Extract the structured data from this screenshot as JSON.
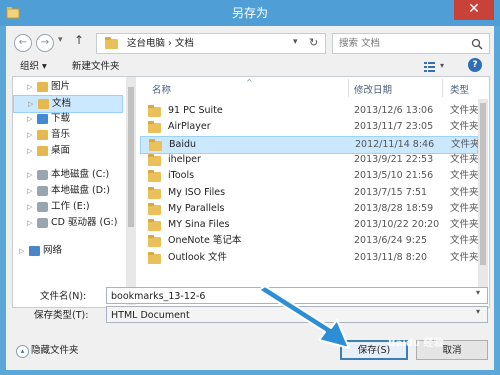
{
  "window": {
    "title": "另存为",
    "close_label": "✕"
  },
  "nav": {
    "back": "←",
    "forward": "→",
    "dropdown": "▾",
    "up": "↑"
  },
  "address": {
    "path": "这台电脑 › 文档",
    "chevron": "▾",
    "refresh": "↻"
  },
  "search": {
    "placeholder": "搜索 文档"
  },
  "toolbar": {
    "organize": "组织 ▾",
    "new_folder": "新建文件夹",
    "help": "?"
  },
  "sidebar": {
    "items": [
      {
        "label": "图片",
        "icon": "pictures-icon",
        "selected": false
      },
      {
        "label": "文档",
        "icon": "documents-icon",
        "selected": true
      },
      {
        "label": "下载",
        "icon": "downloads-icon",
        "selected": false
      },
      {
        "label": "音乐",
        "icon": "music-icon",
        "selected": false
      },
      {
        "label": "桌面",
        "icon": "desktop-icon",
        "selected": false
      },
      {
        "label": "本地磁盘 (C:)",
        "icon": "drive-icon",
        "selected": false
      },
      {
        "label": "本地磁盘 (D:)",
        "icon": "drive-icon",
        "selected": false
      },
      {
        "label": "工作 (E:)",
        "icon": "drive-icon",
        "selected": false
      },
      {
        "label": "CD 驱动器 (G:)",
        "icon": "cd-drive-icon",
        "selected": false
      },
      {
        "label": "网络",
        "icon": "network-icon",
        "selected": false
      }
    ]
  },
  "file_list": {
    "columns": [
      "名称",
      "修改日期",
      "类型"
    ],
    "rows": [
      {
        "name": "91 PC Suite",
        "date": "2013/12/6 13:06",
        "type": "文件夹",
        "selected": false
      },
      {
        "name": "AirPlayer",
        "date": "2013/11/7 23:05",
        "type": "文件夹",
        "selected": false
      },
      {
        "name": "Baidu",
        "date": "2012/11/14 8:46",
        "type": "文件夹",
        "selected": true
      },
      {
        "name": "ihelper",
        "date": "2013/9/21 22:53",
        "type": "文件夹",
        "selected": false
      },
      {
        "name": "iTools",
        "date": "2013/5/10 21:56",
        "type": "文件夹",
        "selected": false
      },
      {
        "name": "My ISO Files",
        "date": "2013/7/15 7:51",
        "type": "文件夹",
        "selected": false
      },
      {
        "name": "My Parallels",
        "date": "2013/8/28 18:59",
        "type": "文件夹",
        "selected": false
      },
      {
        "name": "MY Sina Files",
        "date": "2013/10/22 20:20",
        "type": "文件夹",
        "selected": false
      },
      {
        "name": "OneNote 笔记本",
        "date": "2013/6/24 9:25",
        "type": "文件夹",
        "selected": false
      },
      {
        "name": "Outlook 文件",
        "date": "2013/11/8 8:20",
        "type": "文件夹",
        "selected": false
      }
    ]
  },
  "form": {
    "filename_label": "文件名(N):",
    "filename_value": "bookmarks_13-12-6",
    "filetype_label": "保存类型(T):",
    "filetype_value": "HTML Document"
  },
  "footer": {
    "hide_folders": "隐藏文件夹",
    "save": "保存(S)",
    "cancel": "取消"
  },
  "watermark": "Baidu 经验",
  "colors": {
    "accent": "#4f9fd6",
    "selection": "#cce8ff",
    "arrow": "#2d8ed8"
  }
}
